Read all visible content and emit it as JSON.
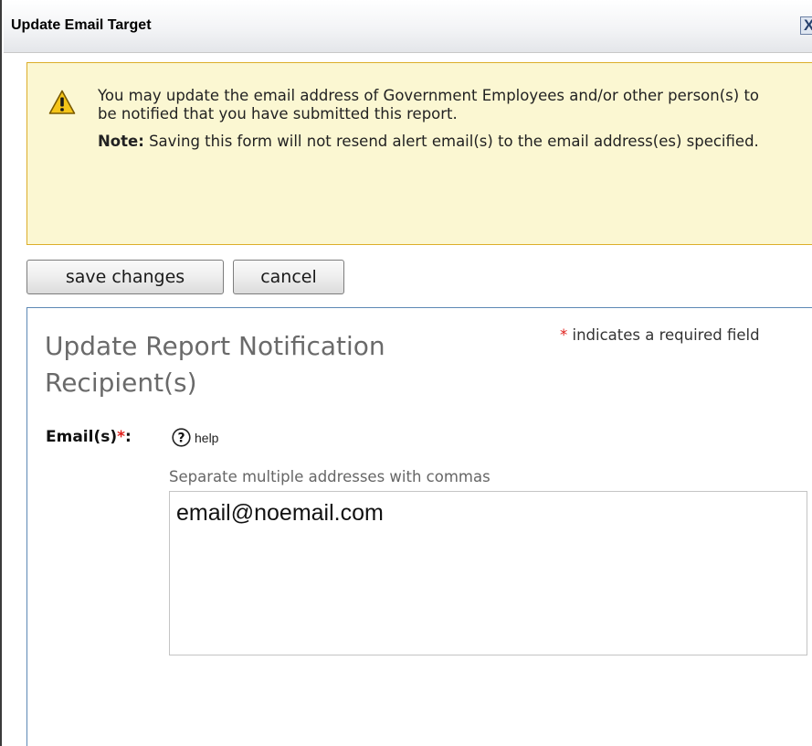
{
  "dialog": {
    "title": "Update Email Target",
    "close_label": "X",
    "close_icon": "close-icon"
  },
  "alert": {
    "icon": "warning-icon",
    "message": "You may update the email address of Government Employees and/or other person(s) to be notified that you have submitted this report.",
    "note_label": "Note:",
    "note_text": " Saving this form will not resend alert email(s) to the email address(es) specified.",
    "background_color": "#fbf7d2",
    "border_color": "#dcae2a"
  },
  "toolbar": {
    "save_label": "save changes",
    "cancel_label": "cancel"
  },
  "form": {
    "required_star": "*",
    "required_note": " indicates a required field",
    "title": "Update Report Notification Recipient(s)",
    "email_label": "Email(s)",
    "email_required_star": "*",
    "email_label_colon": ":",
    "help_icon": "help-icon",
    "help_label": "help",
    "email_hint": "Separate multiple addresses with commas",
    "email_value": "email@noemail.com",
    "required_color": "#e0201c",
    "panel_border_color": "#5d88b5"
  }
}
